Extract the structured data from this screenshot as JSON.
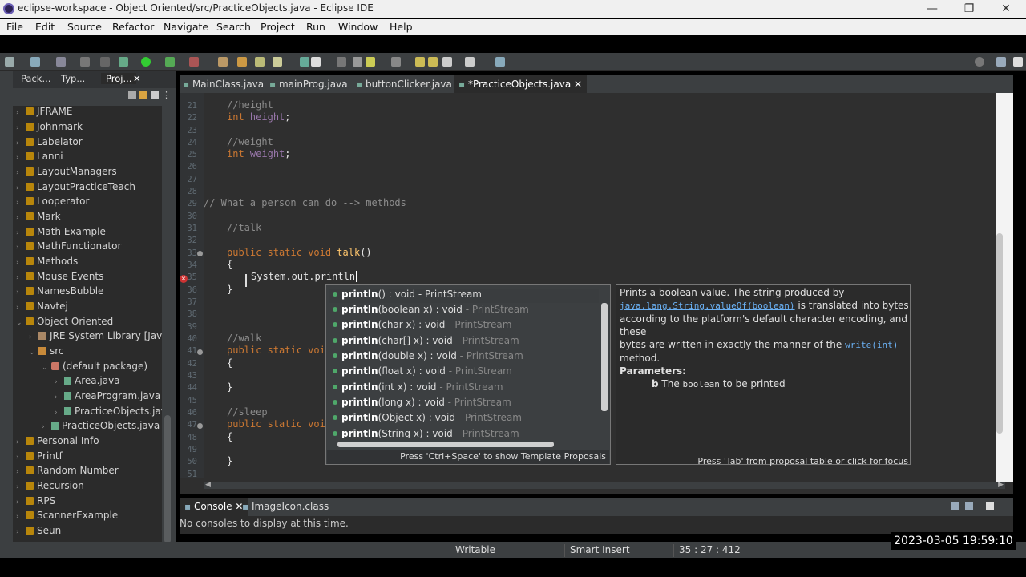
{
  "window": {
    "title": "eclipse-workspace - Object Oriented/src/PracticeObjects.java - Eclipse IDE",
    "minimize": "—",
    "maximize": "❐",
    "close": "✕"
  },
  "menu": [
    "File",
    "Edit",
    "Source",
    "Refactor",
    "Navigate",
    "Search",
    "Project",
    "Run",
    "Window",
    "Help"
  ],
  "left_tabs": [
    {
      "label": "Pack..."
    },
    {
      "label": "Typ..."
    },
    {
      "label": "Proj..."
    }
  ],
  "tree": [
    {
      "label": "JFRAME",
      "type": "project"
    },
    {
      "label": "Johnmark",
      "type": "project"
    },
    {
      "label": "Labelator",
      "type": "project"
    },
    {
      "label": "Lanni",
      "type": "project"
    },
    {
      "label": "LayoutManagers",
      "type": "project"
    },
    {
      "label": "LayoutPracticeTeach",
      "type": "project"
    },
    {
      "label": "Looperator",
      "type": "project"
    },
    {
      "label": "Mark",
      "type": "project"
    },
    {
      "label": "Math Example",
      "type": "project"
    },
    {
      "label": "MathFunctionator",
      "type": "project"
    },
    {
      "label": "Methods",
      "type": "project"
    },
    {
      "label": "Mouse Events",
      "type": "project"
    },
    {
      "label": "NamesBubble",
      "type": "project"
    },
    {
      "label": "Navtej",
      "type": "project"
    },
    {
      "label": "Object Oriented",
      "type": "project-open"
    },
    {
      "label": "JRE System Library [JavaSE",
      "type": "lib"
    },
    {
      "label": "src",
      "type": "src"
    },
    {
      "label": "(default package)",
      "type": "pkg"
    },
    {
      "label": "Area.java",
      "type": "java"
    },
    {
      "label": "AreaProgram.java",
      "type": "java"
    },
    {
      "label": "PracticeObjects.java",
      "type": "java"
    },
    {
      "label": "PracticeObjects.java",
      "type": "java"
    },
    {
      "label": "Personal Info",
      "type": "project"
    },
    {
      "label": "Printf",
      "type": "project"
    },
    {
      "label": "Random Number",
      "type": "project"
    },
    {
      "label": "Recursion",
      "type": "project"
    },
    {
      "label": "RPS",
      "type": "project"
    },
    {
      "label": "ScannerExample",
      "type": "project"
    },
    {
      "label": "Seun",
      "type": "project"
    }
  ],
  "editor_tabs": [
    {
      "label": "MainClass.java"
    },
    {
      "label": "mainProg.java"
    },
    {
      "label": "buttonClicker.java"
    },
    {
      "label": "*PracticeObjects.java"
    }
  ],
  "line_numbers": [
    "21",
    "22",
    "23",
    "24",
    "25",
    "26",
    "27",
    "28",
    "29",
    "30",
    "31",
    "32",
    "33",
    "34",
    "35",
    "36",
    "37",
    "38",
    "39",
    "40",
    "41",
    "42",
    "43",
    "44",
    "45",
    "46",
    "47",
    "48",
    "49",
    "50",
    "51"
  ],
  "code": {
    "l21": "//height",
    "l22_kw": "int",
    "l22_id": "height",
    "l24": "//weight",
    "l25_kw": "int",
    "l25_id": "weight",
    "l29": "// What a person can do --> methods",
    "l31": "//talk",
    "l33_kw": "public static void",
    "l33_fn": "talk",
    "l33_rest": "()",
    "l34": "{",
    "l35": "System.out.println",
    "l36": "}",
    "l40": "//walk",
    "l41_kw": "public static voi",
    "l42": "{",
    "l44": "}",
    "l46": "//sleep",
    "l47_kw": "public static voi",
    "l48": "{",
    "l50": "}"
  },
  "proposals": [
    {
      "name": "println",
      "sig": "() : void",
      "ret": " - PrintStream"
    },
    {
      "name": "println",
      "sig": "(boolean x) : void",
      "ret": " - PrintStream"
    },
    {
      "name": "println",
      "sig": "(char x) : void",
      "ret": " - PrintStream"
    },
    {
      "name": "println",
      "sig": "(char[] x) : void",
      "ret": " - PrintStream"
    },
    {
      "name": "println",
      "sig": "(double x) : void",
      "ret": " - PrintStream"
    },
    {
      "name": "println",
      "sig": "(float x) : void",
      "ret": " - PrintStream"
    },
    {
      "name": "println",
      "sig": "(int x) : void",
      "ret": " - PrintStream"
    },
    {
      "name": "println",
      "sig": "(long x) : void",
      "ret": " - PrintStream"
    },
    {
      "name": "println",
      "sig": "(Object x) : void",
      "ret": " - PrintStream"
    },
    {
      "name": "println",
      "sig": "(String x) : void",
      "ret": " - PrintStream"
    }
  ],
  "proposal_footer": "Press 'Ctrl+Space' to show Template Proposals",
  "doc": {
    "p1": "Prints a boolean value. The string produced by",
    "link1": "java.lang.String.valueOf(boolean)",
    "p2": " is translated into bytes",
    "p3": "according to the platform's default character encoding, and these",
    "p4": "bytes are written in exactly the manner of the ",
    "link2": "write(int)",
    "p5": " method.",
    "params_label": "Parameters:",
    "param_name": "b",
    "param_pre": " The ",
    "param_code": "boolean",
    "param_post": " to be printed",
    "footer": "Press 'Tab' from proposal table or click for focus"
  },
  "console": {
    "tab1": "Console",
    "tab2": "ImageIcon.class",
    "message": "No consoles to display at this time."
  },
  "status": {
    "writable": "Writable",
    "insert": "Smart Insert",
    "position": "35 : 27 : 412"
  },
  "timestamp": "2023-03-05  19:59:10"
}
